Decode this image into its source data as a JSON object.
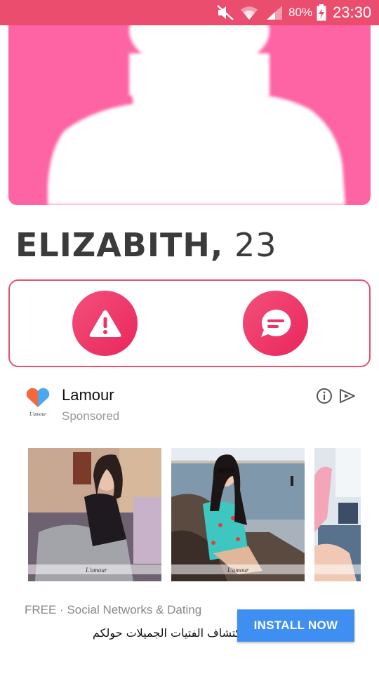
{
  "status_bar": {
    "battery_percent": "80%",
    "time": "23:30",
    "icons": [
      "mute-icon",
      "wifi-icon",
      "signal-icon",
      "battery-charging-icon"
    ]
  },
  "profile": {
    "name": "ELIZABITH,",
    "age": "23",
    "photo_icon": "avatar-placeholder-icon",
    "actions": [
      {
        "icon": "warning-icon",
        "meaning": "report"
      },
      {
        "icon": "chat-icon",
        "meaning": "message"
      }
    ]
  },
  "ad": {
    "app_name": "Lamour",
    "sponsored": "Sponsored",
    "logo_text": "L'amour",
    "watermark": "L'amour",
    "category": "FREE · Social Networks & Dating",
    "description": "اكتشاف الفتيات الجميلات حولكم",
    "install_label": "INSTALL NOW",
    "icons": [
      "info-icon",
      "ad-choices-icon"
    ]
  },
  "colors": {
    "status_bar": "#ea4d6d",
    "photo_background": "#fe63a4",
    "accent": "#e9265d",
    "install_button": "#3f8ef2"
  }
}
